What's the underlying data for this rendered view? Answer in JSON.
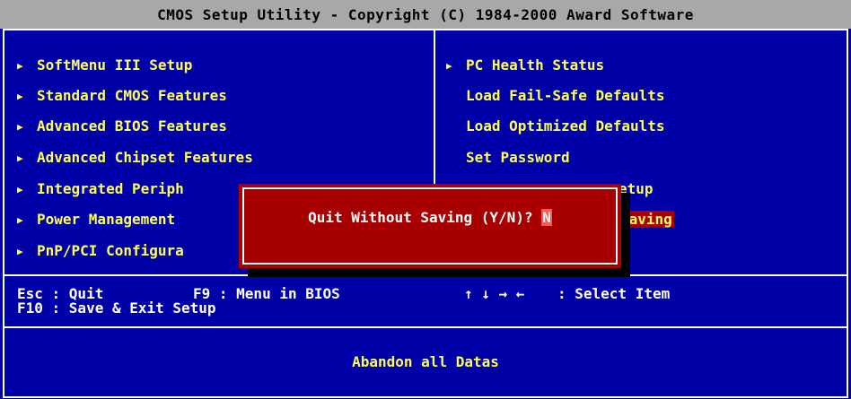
{
  "title": "CMOS Setup Utility - Copyright (C) 1984-2000 Award Software",
  "left_menu": [
    {
      "label": "SoftMenu III Setup",
      "arrow": true
    },
    {
      "label": "Standard CMOS Features",
      "arrow": true
    },
    {
      "label": "Advanced BIOS Features",
      "arrow": true
    },
    {
      "label": "Advanced Chipset Features",
      "arrow": true
    },
    {
      "label": "Integrated Periph",
      "arrow": true
    },
    {
      "label": "Power Management",
      "arrow": true
    },
    {
      "label": "PnP/PCI Configura",
      "arrow": true
    }
  ],
  "right_menu": [
    {
      "label": "PC Health Status",
      "arrow": true
    },
    {
      "label": "Load Fail-Safe Defaults",
      "arrow": false
    },
    {
      "label": "Load Optimized Defaults",
      "arrow": false
    },
    {
      "label": "Set Password",
      "arrow": false
    },
    {
      "label": "etup",
      "arrow": false
    },
    {
      "label": "Saving",
      "arrow": false
    }
  ],
  "help": {
    "esc": "Esc : Quit",
    "f9": "F9 : Menu in BIOS",
    "f10": "F10 : Save & Exit Setup",
    "arrows": "↑ ↓ → ←",
    "select": ": Select Item"
  },
  "description": "Abandon all Datas",
  "dialog": {
    "prompt": "Quit Without Saving (Y/N)?",
    "value": "N"
  },
  "colors": {
    "background": "#0000a8",
    "menu_text": "#ffff55",
    "dialog_bg": "#a80000",
    "title_bg": "#a8a8a8"
  }
}
